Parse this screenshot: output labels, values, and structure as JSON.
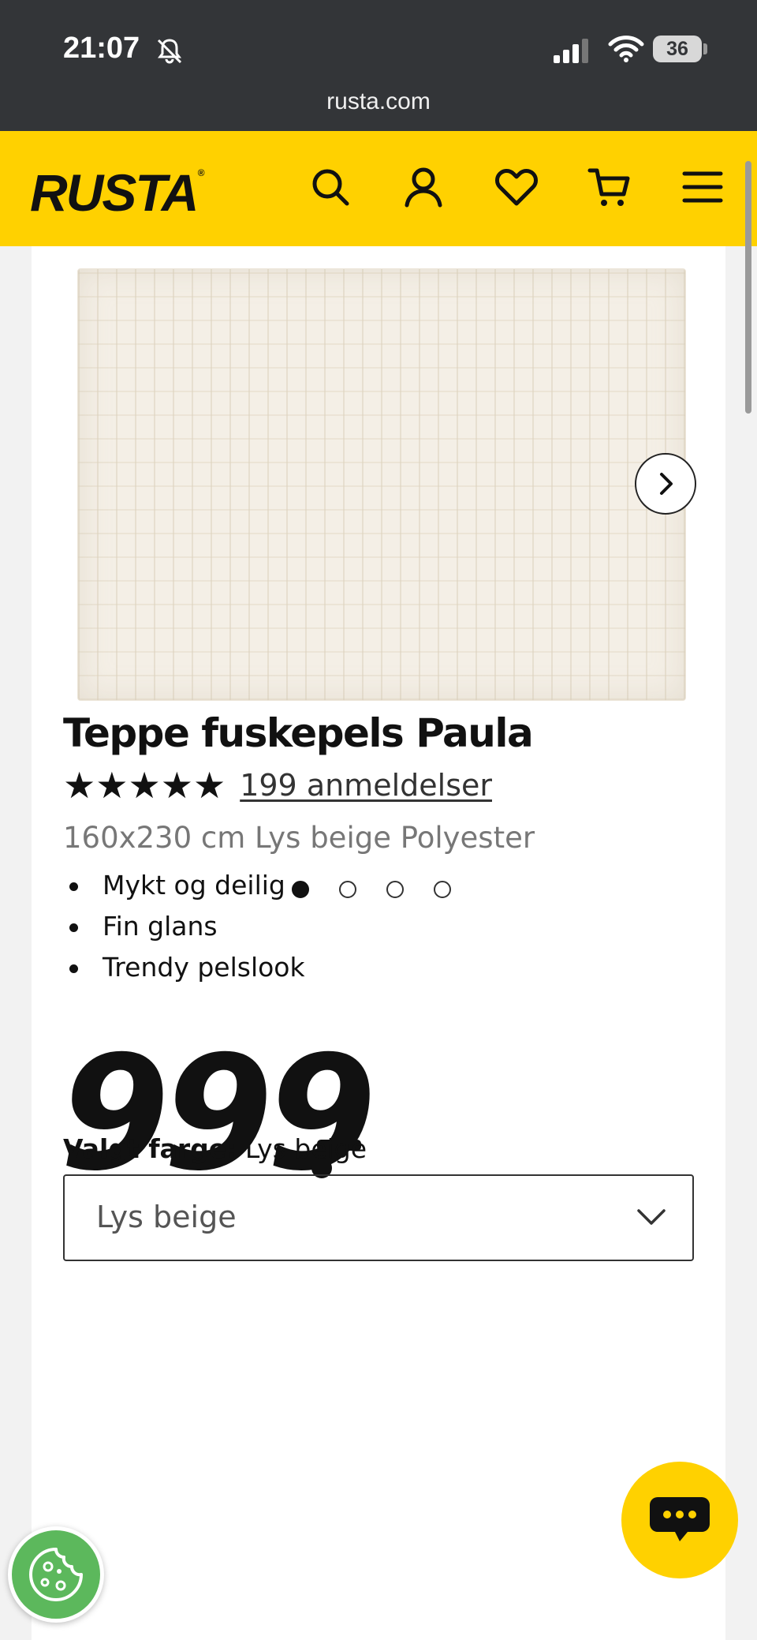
{
  "status_bar": {
    "time": "21:07",
    "battery": "36",
    "url": "rusta.com",
    "icons": [
      "bell-muted-icon",
      "signal-icon",
      "wifi-icon",
      "battery-icon"
    ]
  },
  "header": {
    "logo": "RUSTA",
    "logo_mark": "®",
    "icons": [
      "search-icon",
      "account-icon",
      "heart-icon",
      "cart-icon",
      "menu-icon"
    ],
    "brand_color": "#ffd100"
  },
  "gallery": {
    "image_count": 4,
    "active_index": 0
  },
  "product": {
    "title": "Teppe fuskepels Paula",
    "stars": "★★★★★",
    "rating_value": 5,
    "reviews": "199 anmeldelser",
    "spec": "160x230 cm Lys beige Polyester",
    "features": [
      "Mykt og deilig",
      "Fin glans",
      "Trendy pelslook"
    ],
    "price": "999"
  },
  "color": {
    "label": "Valgt farge:",
    "value": "Lys beige",
    "select_value": "Lys beige"
  },
  "floating": {
    "chat_icon": "chat-icon",
    "cookie_icon": "cookie-icon"
  }
}
